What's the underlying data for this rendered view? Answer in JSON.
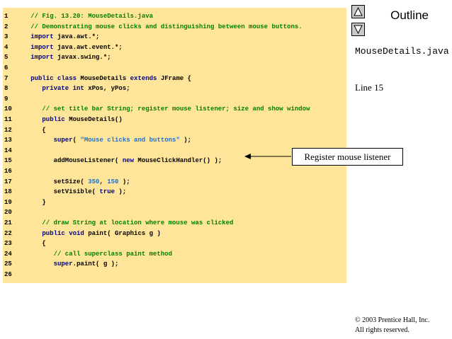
{
  "code": {
    "lines": [
      {
        "num": "1",
        "tokens": [
          {
            "t": "   // Fig. 13.20: MouseDetails.java",
            "k": "comment"
          }
        ]
      },
      {
        "num": "2",
        "tokens": [
          {
            "t": "   // Demonstrating mouse clicks and distinguishing between mouse buttons.",
            "k": "comment"
          }
        ]
      },
      {
        "num": "3",
        "tokens": [
          {
            "t": "   import",
            "k": "keyword"
          },
          {
            "t": " java.awt.*;",
            "k": "plain"
          }
        ]
      },
      {
        "num": "4",
        "tokens": [
          {
            "t": "   import",
            "k": "keyword"
          },
          {
            "t": " java.awt.event.*;",
            "k": "plain"
          }
        ]
      },
      {
        "num": "5",
        "tokens": [
          {
            "t": "   import",
            "k": "keyword"
          },
          {
            "t": " javax.swing.*;",
            "k": "plain"
          }
        ]
      },
      {
        "num": "6",
        "tokens": []
      },
      {
        "num": "7",
        "tokens": [
          {
            "t": "   public class",
            "k": "keyword"
          },
          {
            "t": " MouseDetails ",
            "k": "plain"
          },
          {
            "t": "extends",
            "k": "keyword"
          },
          {
            "t": " JFrame {",
            "k": "plain"
          }
        ]
      },
      {
        "num": "8",
        "tokens": [
          {
            "t": "      private int",
            "k": "keyword"
          },
          {
            "t": " xPos, yPos;",
            "k": "plain"
          }
        ]
      },
      {
        "num": "9",
        "tokens": []
      },
      {
        "num": "10",
        "tokens": [
          {
            "t": "      // set title bar String; register mouse listener; size and show window",
            "k": "comment"
          }
        ]
      },
      {
        "num": "11",
        "tokens": [
          {
            "t": "      public",
            "k": "keyword"
          },
          {
            "t": " MouseDetails()",
            "k": "plain"
          }
        ]
      },
      {
        "num": "12",
        "tokens": [
          {
            "t": "      {",
            "k": "plain"
          }
        ]
      },
      {
        "num": "13",
        "tokens": [
          {
            "t": "         super",
            "k": "keyword"
          },
          {
            "t": "( ",
            "k": "plain"
          },
          {
            "t": "\"Mouse clicks and buttons\"",
            "k": "string"
          },
          {
            "t": " );",
            "k": "plain"
          }
        ]
      },
      {
        "num": "14",
        "tokens": []
      },
      {
        "num": "15",
        "tokens": [
          {
            "t": "         addMouseListener( ",
            "k": "plain"
          },
          {
            "t": "new",
            "k": "keyword"
          },
          {
            "t": " MouseClickHandler() );",
            "k": "plain"
          }
        ]
      },
      {
        "num": "16",
        "tokens": []
      },
      {
        "num": "17",
        "tokens": [
          {
            "t": "         setSize( ",
            "k": "plain"
          },
          {
            "t": "350",
            "k": "number"
          },
          {
            "t": ", ",
            "k": "plain"
          },
          {
            "t": "150",
            "k": "number"
          },
          {
            "t": " );",
            "k": "plain"
          }
        ]
      },
      {
        "num": "18",
        "tokens": [
          {
            "t": "         setVisible( ",
            "k": "plain"
          },
          {
            "t": "true",
            "k": "keyword"
          },
          {
            "t": " );",
            "k": "plain"
          }
        ]
      },
      {
        "num": "19",
        "tokens": [
          {
            "t": "      }",
            "k": "plain"
          }
        ]
      },
      {
        "num": "20",
        "tokens": []
      },
      {
        "num": "21",
        "tokens": [
          {
            "t": "      // draw String at location where mouse was clicked",
            "k": "comment"
          }
        ]
      },
      {
        "num": "22",
        "tokens": [
          {
            "t": "      public void",
            "k": "keyword"
          },
          {
            "t": " paint( Graphics g )",
            "k": "plain"
          }
        ]
      },
      {
        "num": "23",
        "tokens": [
          {
            "t": "      {",
            "k": "plain"
          }
        ]
      },
      {
        "num": "24",
        "tokens": [
          {
            "t": "         // call superclass paint method",
            "k": "comment"
          }
        ]
      },
      {
        "num": "25",
        "tokens": [
          {
            "t": "         super",
            "k": "keyword"
          },
          {
            "t": ".paint( g );",
            "k": "plain"
          }
        ]
      },
      {
        "num": "26",
        "tokens": []
      }
    ]
  },
  "sidebar": {
    "outline_title": "Outline",
    "file_name": "MouseDetails.java",
    "line_ref": "Line 15"
  },
  "callout": {
    "text": "Register mouse listener"
  },
  "footer": {
    "copyright_line1": "© 2003 Prentice Hall, Inc.",
    "copyright_line2": "All rights reserved."
  },
  "colors": {
    "code_background": "#ffe599",
    "comment": "#008000",
    "keyword": "#000080",
    "string": "#1f6fcf"
  }
}
